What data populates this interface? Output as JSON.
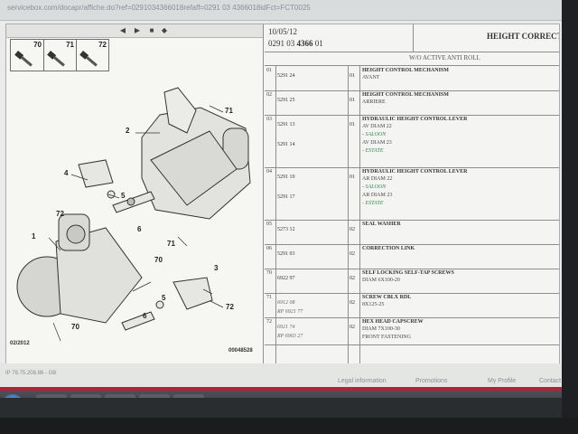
{
  "browser": {
    "url": "servicebox.com/docapr/affiche.do?ref=0291034366018refaff=0291 03 4366018idFct=FCT0025"
  },
  "diagram": {
    "screw_labels": [
      "70",
      "71",
      "72"
    ],
    "callouts": [
      "71",
      "2",
      "4",
      "5",
      "72",
      "6",
      "1",
      "71",
      "70",
      "5",
      "3",
      "6",
      "72",
      "70"
    ],
    "footer_left": "02/2012",
    "footer_right": "00048528"
  },
  "header": {
    "date": "10/05/12",
    "ref_prefix": "0291 03 ",
    "ref_bold": "4366",
    "ref_suffix": " 01",
    "title": "HEIGHT CORRECTOR"
  },
  "subheader": "W/O ACTIVE ANTI ROLL",
  "rows": [
    {
      "n": "01",
      "codes": [
        "5291 24"
      ],
      "qty": "01",
      "title": "HEIGHT CONTROL MECHANISM",
      "lines": [
        "AVANT"
      ]
    },
    {
      "n": "02",
      "codes": [
        "5291 25"
      ],
      "qty": "01",
      "title": "HEIGHT CONTROL MECHANISM",
      "lines": [
        "ARRIERE"
      ]
    },
    {
      "n": "03",
      "codes": [
        "5291 13",
        "5291 14"
      ],
      "qty": "01",
      "title": "HYDRAULIC HEIGHT CONTROL LEVER",
      "lines": [
        "AV DIAM 22",
        "- SALOON",
        "AV DIAM 23",
        "- ESTATE"
      ]
    },
    {
      "n": "04",
      "codes": [
        "5291 19",
        "5291 17"
      ],
      "qty": "01",
      "title": "HYDRAULIC HEIGHT CONTROL LEVER",
      "lines": [
        "AR DIAM 22",
        "- SALOON",
        "AR DIAM 23",
        "- ESTATE"
      ]
    },
    {
      "n": "05",
      "codes": [
        "5273 12"
      ],
      "qty": "02",
      "title": "SEAL WASHER",
      "lines": []
    },
    {
      "n": "06",
      "codes": [
        "5291 03"
      ],
      "qty": "02",
      "title": "CORRECTION LINK",
      "lines": []
    },
    {
      "n": "70",
      "codes": [
        "6922 97"
      ],
      "qty": "02",
      "title": "SELF LOCKING SELF-TAP SCREWS",
      "lines": [
        "DIAM 6X100-20"
      ]
    },
    {
      "n": "71",
      "codes": [
        "6912 08",
        "RP 6921 77"
      ],
      "qty": "02",
      "title": "SCREW CBLX RDL",
      "lines": [
        "8X125-25"
      ]
    },
    {
      "n": "72",
      "codes": [
        "6921 74",
        "RP 6903 27"
      ],
      "qty": "02",
      "title": "HEX HEAD CAPSCREW",
      "lines": [
        "DIAM 7X100-30",
        "FRONT FASTENING"
      ]
    }
  ],
  "footer": {
    "status": "IP 78.75.208.86 - GB",
    "links": [
      "Legal information",
      "Promotions",
      "My Profile",
      "Contact"
    ]
  },
  "colors": {
    "accent_red": "#b0243a",
    "green_note": "#2b8a4b"
  }
}
